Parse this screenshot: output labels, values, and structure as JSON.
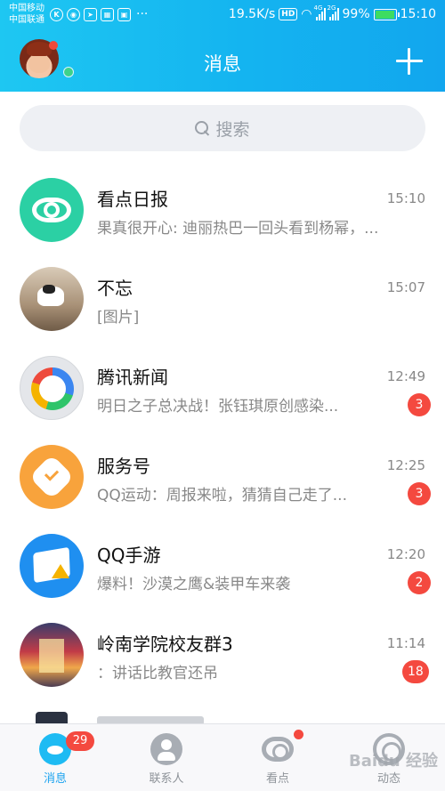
{
  "status_bar": {
    "carrier_1": "中国移动",
    "carrier_2": "中国联通",
    "more": "···",
    "network_speed": "19.5K/s",
    "hd": "HD",
    "signal_1_label": "4G",
    "signal_2_label": "2G",
    "battery": "99%",
    "clock": "15:10"
  },
  "header": {
    "title": "消息",
    "plus_symbol": "+"
  },
  "search": {
    "placeholder": "搜索"
  },
  "chats": [
    {
      "name": "看点日报",
      "time": "15:10",
      "preview": "果真很开心: 迪丽热巴一回头看到杨幂，...",
      "badge": ""
    },
    {
      "name": "不忘",
      "time": "15:07",
      "preview": "[图片]",
      "badge": ""
    },
    {
      "name": "腾讯新闻",
      "time": "12:49",
      "preview": "明日之子总决战！张钰琪原创感染...",
      "badge": "3"
    },
    {
      "name": "服务号",
      "time": "12:25",
      "preview": "QQ运动：周报来啦，猜猜自己走了...",
      "badge": "3"
    },
    {
      "name": "QQ手游",
      "time": "12:20",
      "preview": "爆料！沙漠之鹰&装甲车来袭",
      "badge": "2"
    },
    {
      "name": "岭南学院校友群3",
      "time": "11:14",
      "preview": "：讲话比教官还吊",
      "badge": "18"
    }
  ],
  "tabs": [
    {
      "label": "消息",
      "badge": "29"
    },
    {
      "label": "联系人"
    },
    {
      "label": "看点"
    },
    {
      "label": "动态"
    }
  ],
  "watermark": "Baidu 经验",
  "colors": {
    "header_start": "#1ec7f2",
    "header_end": "#12a6ee",
    "badge": "#f4493f",
    "active_tab": "#1ca3ef"
  }
}
